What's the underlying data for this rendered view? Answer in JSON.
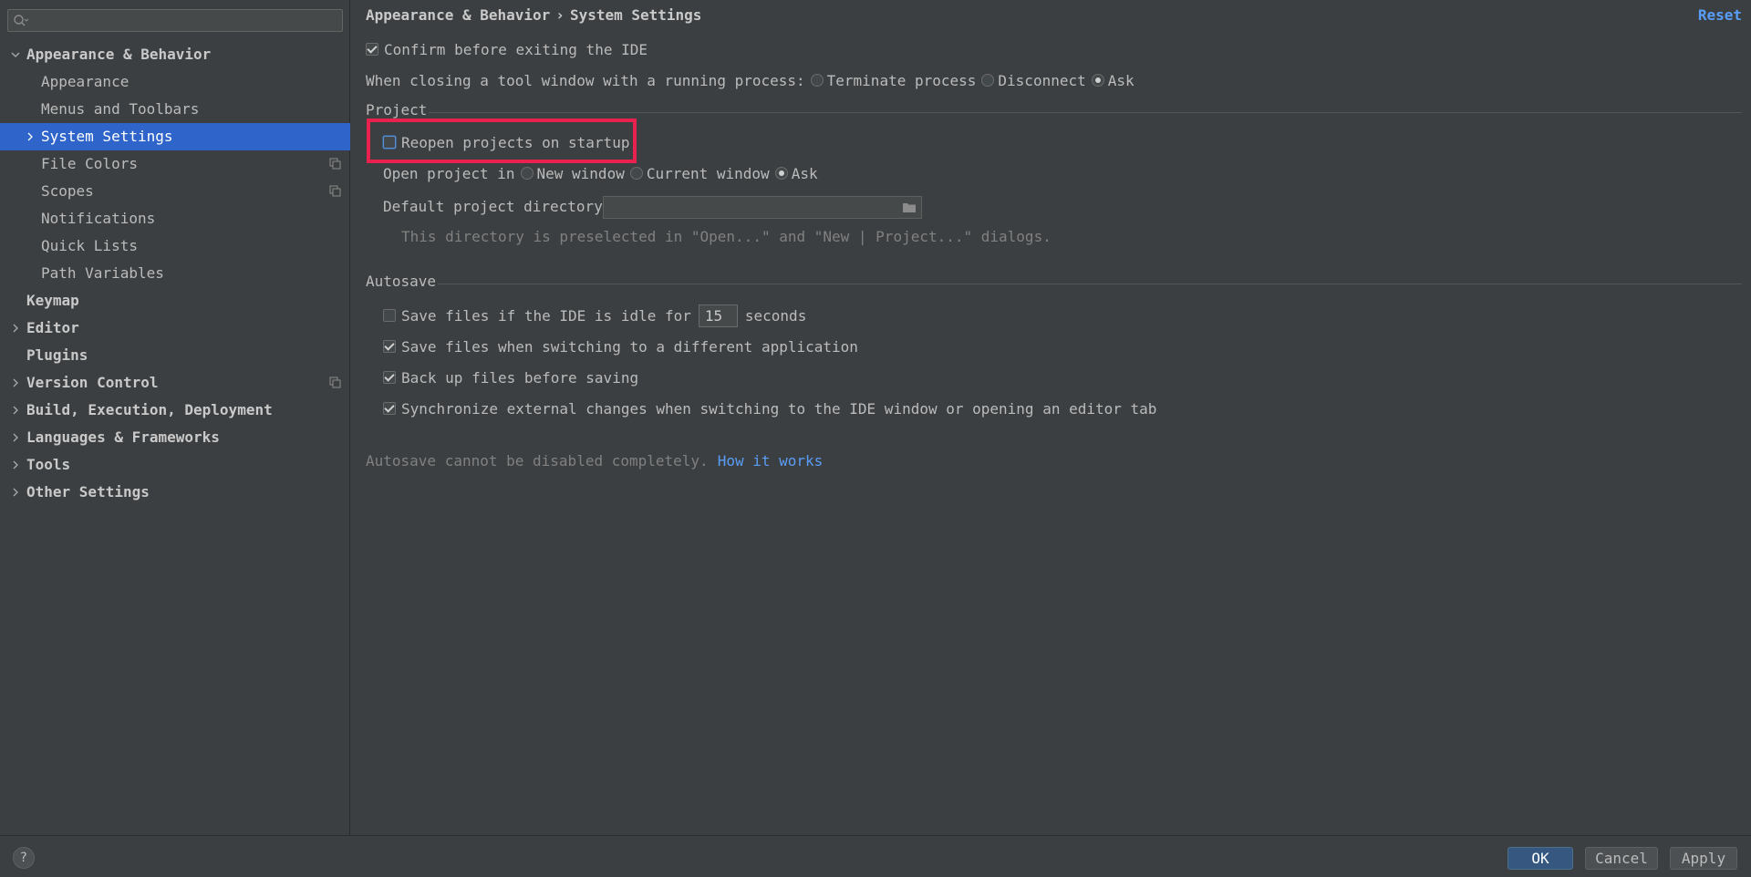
{
  "sidebar": {
    "search": {
      "value": "",
      "placeholder": ""
    },
    "items": [
      {
        "label": "Appearance & Behavior",
        "level": 0,
        "expanded": true
      },
      {
        "label": "Appearance",
        "level": 1
      },
      {
        "label": "Menus and Toolbars",
        "level": 1
      },
      {
        "label": "System Settings",
        "level": 1,
        "selected": true,
        "collapsed": true
      },
      {
        "label": "File Colors",
        "level": 1,
        "project_icon": true
      },
      {
        "label": "Scopes",
        "level": 1,
        "project_icon": true
      },
      {
        "label": "Notifications",
        "level": 1
      },
      {
        "label": "Quick Lists",
        "level": 1
      },
      {
        "label": "Path Variables",
        "level": 1
      },
      {
        "label": "Keymap",
        "level": 0
      },
      {
        "label": "Editor",
        "level": 0,
        "collapsed": true
      },
      {
        "label": "Plugins",
        "level": 0
      },
      {
        "label": "Version Control",
        "level": 0,
        "collapsed": true,
        "project_icon": true
      },
      {
        "label": "Build, Execution, Deployment",
        "level": 0,
        "collapsed": true
      },
      {
        "label": "Languages & Frameworks",
        "level": 0,
        "collapsed": true
      },
      {
        "label": "Tools",
        "level": 0,
        "collapsed": true
      },
      {
        "label": "Other Settings",
        "level": 0,
        "collapsed": true
      }
    ]
  },
  "header": {
    "crumb1": "Appearance & Behavior",
    "separator": "›",
    "crumb2": "System Settings",
    "reset_label": "Reset"
  },
  "general": {
    "confirm_exit_label": "Confirm before exiting the IDE",
    "confirm_exit_checked": true,
    "closing_label": "When closing a tool window with a running process:",
    "closing_options": [
      "Terminate process",
      "Disconnect",
      "Ask"
    ],
    "closing_selected": "Ask"
  },
  "project": {
    "section_title": "Project",
    "reopen_label": "Reopen projects on startup",
    "reopen_checked": false,
    "open_in_label": "Open project in",
    "open_in_options": [
      "New window",
      "Current window",
      "Ask"
    ],
    "open_in_selected": "Ask",
    "default_dir_label": "Default project directory:",
    "default_dir_value": "",
    "default_dir_hint": "This directory is preselected in \"Open...\" and \"New | Project...\" dialogs."
  },
  "autosave": {
    "section_title": "Autosave",
    "idle_label_before": "Save files if the IDE is idle for",
    "idle_seconds": "15",
    "idle_label_after": "seconds",
    "idle_checked": false,
    "switch_app_label": "Save files when switching to a different application",
    "switch_app_checked": true,
    "backup_label": "Back up files before saving",
    "backup_checked": true,
    "sync_label": "Synchronize external changes when switching to the IDE window or opening an editor tab",
    "sync_checked": true,
    "note": "Autosave cannot be disabled completely.",
    "note_link": "How it works"
  },
  "footer": {
    "help_label": "?",
    "ok_label": "OK",
    "cancel_label": "Cancel",
    "apply_label": "Apply"
  },
  "colors": {
    "background": "#3c3f41",
    "selection": "#2f65ca",
    "link": "#589df6",
    "highlight": "#e8214f",
    "primary_button": "#365880"
  }
}
